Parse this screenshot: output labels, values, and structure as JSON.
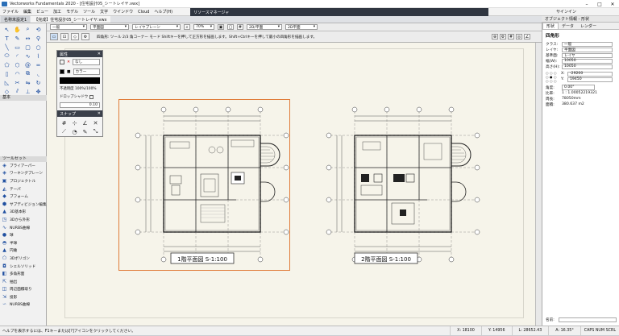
{
  "window": {
    "title": "Vectorworks Fundamentals 2020 - [住宅設計05_シートレイヤ.vwx]"
  },
  "menu": [
    "ファイル",
    "編集",
    "ビュー",
    "加工",
    "モデル",
    "ツール",
    "文字",
    "ウインドウ",
    "Cloud",
    "ヘルプ(H)"
  ],
  "resource_manager": {
    "title": "リソースマネージャ"
  },
  "tabs": [
    {
      "label": "名称未設定1"
    },
    {
      "label": "【完成】住宅設計05_シートレイヤ.vwx"
    }
  ],
  "info_palette": {
    "title": "オブジェクト情報 - 形状",
    "tabs": [
      "形状",
      "データ",
      "レンダー"
    ],
    "signin": "サインイン"
  },
  "mode_bar": {
    "class": "一般",
    "layer": "平面図",
    "layer_type": "レイヤプレーン",
    "zoom": "70%",
    "view_2d": "2D/平面",
    "view_3d": "2D平面"
  },
  "hint_text": "四角形: ツール 2/3 角コーナー モード  Shiftキーを押して正方形を描画します。Shift+Ctrlキーを押して最小の四角形を描画します。",
  "attributes_palette": {
    "title": "属性",
    "fill_label": "なし",
    "pen_label": "カラー",
    "opacity": "不透明度 100%/100%",
    "drop_shadow": "ドロップシャドウ",
    "line_weight": "0.10"
  },
  "snap_palette": {
    "title": "スナップ"
  },
  "toolsets": {
    "header": "ツールセット",
    "items": [
      "ブライアーパー",
      "ワーキングプレーン",
      "プロジェクトル",
      "テーパ",
      "ブフォーム",
      "サブディビジョン編集",
      "3D基本形",
      "3Dから外形",
      "NURBS曲線",
      "球",
      "半球",
      "円錐",
      "3Dポリゴン",
      "シェルソリッド",
      "多角形面",
      "抽出",
      "周辺面積取り",
      "投影",
      "NURBS曲線"
    ]
  },
  "obj_info": {
    "object_type": "四角形",
    "fields": [
      {
        "label": "クラス:",
        "value": "一般"
      },
      {
        "label": "レイヤ:",
        "value": "平面図"
      },
      {
        "label": "基準面:",
        "value": "レイヤ"
      },
      {
        "label": "幅(W):",
        "value": "10050"
      },
      {
        "label": "高さ(H):",
        "value": "10050"
      }
    ],
    "coords": [
      {
        "label": "X:",
        "value": "-29200"
      },
      {
        "label": "Y:",
        "value": "19450"
      }
    ],
    "readouts": [
      {
        "label": "角度:",
        "value": "0.00°"
      },
      {
        "label": "比率:",
        "value": "1 : 1.00052219321"
      },
      {
        "label": "周長:",
        "value": "78050mm"
      },
      {
        "label": "面積:",
        "value": "380.637 m2"
      }
    ],
    "name_label": "名前:"
  },
  "plans": [
    {
      "label": "1階平面図 S-1:100"
    },
    {
      "label": "2階平面図 S-1:100"
    }
  ],
  "status": {
    "message": "ヘルプを表示するには、F1キーまたは[?]アイコンをクリックしてください。",
    "x": "X: 18100",
    "y": "Y: 14956",
    "l": "L: 28652.43",
    "a": "A: 16.35°",
    "mode": "CAPS NUM SCRL"
  }
}
